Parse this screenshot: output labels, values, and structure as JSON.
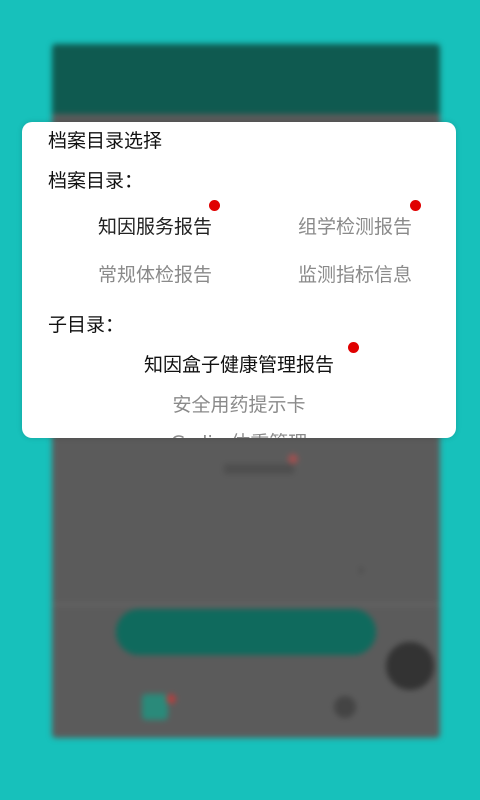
{
  "dialog": {
    "title": "档案目录选择",
    "archive_label": "档案目录：",
    "archive_items": [
      {
        "label": "知因服务报告",
        "selected": true,
        "has_dot": true
      },
      {
        "label": "组学检测报告",
        "selected": false,
        "has_dot": true
      },
      {
        "label": "常规体检报告",
        "selected": false,
        "has_dot": false
      },
      {
        "label": "监测指标信息",
        "selected": false,
        "has_dot": false
      }
    ],
    "sub_label": "子目录：",
    "sub_items": [
      {
        "label": "知因盒子健康管理报告",
        "selected": true,
        "has_dot": true
      },
      {
        "label": "安全用药提示卡",
        "selected": false,
        "has_dot": false
      },
      {
        "label": "G-slim体重管理",
        "selected": false,
        "has_dot": false
      }
    ]
  },
  "colors": {
    "background": "#17c1bb",
    "dot": "#e00000",
    "text_active": "#111111",
    "text_inactive": "#8a8a8a"
  }
}
